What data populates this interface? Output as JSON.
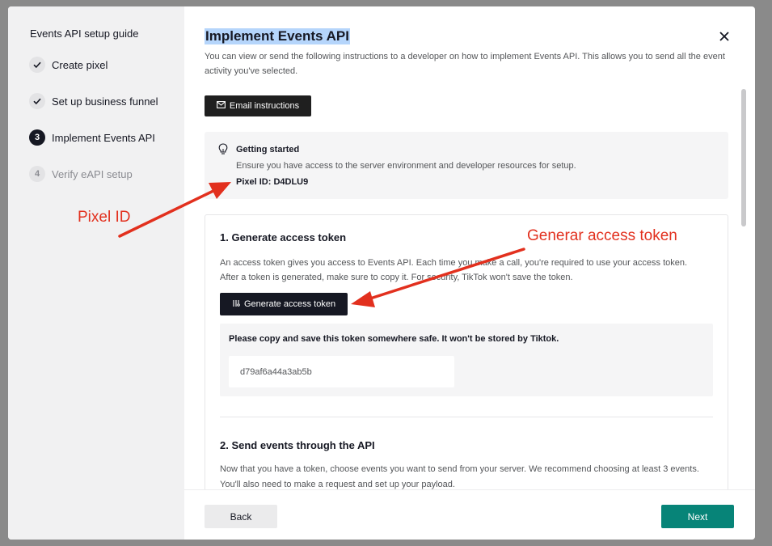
{
  "sidebar": {
    "title": "Events API setup guide",
    "steps": [
      {
        "badge": "",
        "label": "Create pixel",
        "state": "done"
      },
      {
        "badge": "",
        "label": "Set up business funnel",
        "state": "done"
      },
      {
        "badge": "3",
        "label": "Implement Events API",
        "state": "current"
      },
      {
        "badge": "4",
        "label": "Verify eAPI setup",
        "state": "todo"
      }
    ]
  },
  "main": {
    "title": "Implement Events API",
    "intro": "You can view or send the following instructions to a developer on how to implement Events API. This allows you to send all the event activity you've selected.",
    "email_button": "Email instructions",
    "getting_started": {
      "title": "Getting started",
      "description": "Ensure you have access to the server environment and developer resources for setup.",
      "pixel_id": "Pixel ID: D4DLU9"
    },
    "step1": {
      "title": "1. Generate access token",
      "description": "An access token gives you access to Events API. Each time you make a call, you're required to use your access token. After a token is generated, make sure to copy it. For security, TikTok won't save the token.",
      "button": "Generate access token",
      "note": "Please copy and save this token somewhere safe. It won't be stored by Tiktok.",
      "token_value": "d79af6a44a3ab5b"
    },
    "step2": {
      "title": "2. Send events through the API",
      "description": "Now that you have a token, choose events you want to send from your server. We recommend choosing at least 3 events. You'll also need to make a request and set up your payload."
    }
  },
  "footer": {
    "back": "Back",
    "next": "Next"
  },
  "annotations": {
    "pixel_id_label": "Pixel ID",
    "token_label": "Generar access token",
    "color": "#e2301e"
  },
  "colors": {
    "primary": "#078478",
    "dark_button": "#161823",
    "title_highlight": "#b5d5fb"
  }
}
